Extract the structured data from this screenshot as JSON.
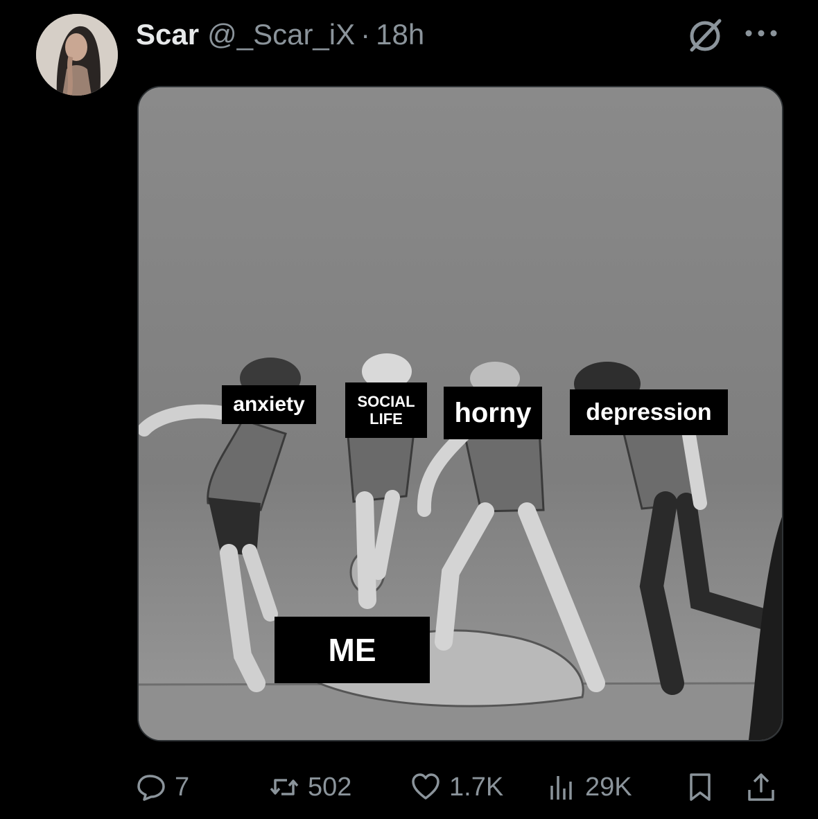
{
  "tweet": {
    "display_name": "Scar",
    "handle": "@_Scar_iX",
    "separator": "·",
    "time": "18h"
  },
  "meme": {
    "labels": {
      "anxiety": "anxiety",
      "social_life": "SOCIAL LIFE",
      "horny": "horny",
      "depression": "depression",
      "me": "ME"
    }
  },
  "actions": {
    "replies": "7",
    "retweets": "502",
    "likes": "1.7K",
    "views": "29K"
  },
  "icons": [
    "avatar",
    "grok-icon",
    "more-icon",
    "reply-icon",
    "retweet-icon",
    "like-icon",
    "views-icon",
    "bookmark-icon",
    "share-icon"
  ],
  "colors": {
    "background": "#000000",
    "text": "#e7e9ea",
    "muted": "#8b949b",
    "border": "#2f3336"
  }
}
